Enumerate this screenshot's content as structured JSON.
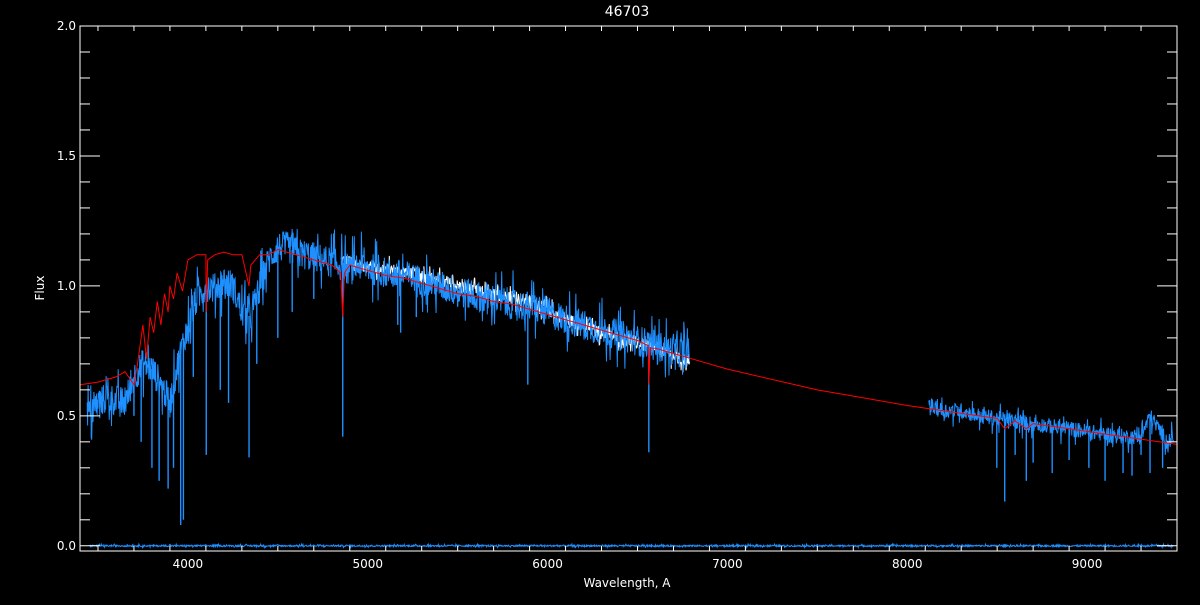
{
  "chart_data": {
    "type": "line",
    "title": "46703",
    "xlabel": "Wavelength, A",
    "ylabel": "Flux",
    "xlim": [
      3400,
      9500
    ],
    "ylim": [
      -0.02,
      2.0
    ],
    "xticks": [
      4000,
      5000,
      6000,
      7000,
      8000,
      9000
    ],
    "xtick_labels": [
      "4000",
      "5000",
      "6000",
      "7000",
      "8000",
      "9000"
    ],
    "yticks": [
      0.0,
      0.5,
      1.0,
      1.5,
      2.0
    ],
    "ytick_labels": [
      "0.0",
      "0.5",
      "1.0",
      "1.5",
      "2.0"
    ],
    "grid": false,
    "background": "#000000",
    "axis_color": "#ffffff",
    "series": [
      {
        "color": "#ffffff",
        "x": [
          4850,
          4950,
          5050,
          5150,
          5250,
          5350,
          5450,
          5550,
          5650,
          5750,
          5850,
          5950,
          6050,
          6150,
          6250,
          6350,
          6450,
          6550,
          6650,
          6700,
          6750,
          6790
        ],
        "y": [
          1.1,
          1.08,
          1.07,
          1.06,
          1.05,
          1.03,
          1.01,
          0.99,
          0.97,
          0.96,
          0.95,
          0.93,
          0.89,
          0.86,
          0.83,
          0.81,
          0.79,
          0.77,
          0.75,
          0.73,
          0.71,
          0.72
        ],
        "noise": 0.025
      },
      {
        "color": "#1e90ff",
        "x": [
          3440,
          3460,
          3500,
          3550,
          3600,
          3650,
          3700,
          3750,
          3800,
          3850,
          3900,
          3950,
          4000,
          4050,
          4100,
          4150,
          4200,
          4250,
          4300,
          4350,
          4400,
          4450,
          4500,
          4550,
          4600,
          4650,
          4700,
          4750,
          4800,
          4850,
          4900,
          4950,
          5000,
          5100,
          5200,
          5300,
          5400,
          5500,
          5600,
          5700,
          5800,
          5900,
          6000,
          6100,
          6200,
          6300,
          6400,
          6500,
          6600,
          6700,
          6790
        ],
        "y": [
          0.52,
          0.5,
          0.55,
          0.57,
          0.56,
          0.55,
          0.65,
          0.7,
          0.68,
          0.62,
          0.55,
          0.72,
          0.85,
          0.95,
          1.0,
          0.99,
          1.02,
          1.0,
          0.9,
          0.88,
          1.0,
          1.1,
          1.15,
          1.15,
          1.13,
          1.12,
          1.11,
          1.1,
          1.09,
          1.08,
          1.06,
          1.08,
          1.07,
          1.05,
          1.04,
          1.02,
          1.0,
          0.98,
          0.96,
          0.95,
          0.93,
          0.92,
          0.9,
          0.87,
          0.85,
          0.83,
          0.81,
          0.79,
          0.77,
          0.75,
          0.74
        ],
        "noise": 0.06,
        "lines": [
          [
            3840,
            0.25
          ],
          [
            3890,
            0.22
          ],
          [
            3960,
            0.08
          ],
          [
            3975,
            0.1
          ],
          [
            4102,
            0.35
          ],
          [
            4340,
            0.34
          ],
          [
            4861,
            0.42
          ],
          [
            5270,
            0.88
          ],
          [
            5890,
            0.62
          ],
          [
            6563,
            0.36
          ],
          [
            3700,
            0.5
          ],
          [
            3740,
            0.4
          ],
          [
            3800,
            0.3
          ],
          [
            3920,
            0.3
          ],
          [
            4030,
            0.65
          ],
          [
            4180,
            0.6
          ],
          [
            4226,
            0.55
          ],
          [
            4383,
            0.7
          ],
          [
            4500,
            0.8
          ],
          [
            4580,
            0.9
          ],
          [
            4700,
            0.95
          ],
          [
            5167,
            0.85
          ],
          [
            5183,
            0.82
          ],
          [
            5500,
            0.92
          ]
        ]
      },
      {
        "color": "#1e90ff",
        "x": [
          8120,
          8150,
          8200,
          8300,
          8400,
          8500,
          8600,
          8700,
          8800,
          8900,
          9000,
          9100,
          9200,
          9300,
          9350,
          9400,
          9450,
          9480
        ],
        "y": [
          0.55,
          0.53,
          0.52,
          0.52,
          0.5,
          0.49,
          0.48,
          0.47,
          0.46,
          0.45,
          0.44,
          0.43,
          0.42,
          0.42,
          0.5,
          0.45,
          0.4,
          0.42
        ],
        "noise": 0.03,
        "lines": [
          [
            8498,
            0.3
          ],
          [
            8542,
            0.17
          ],
          [
            8662,
            0.25
          ],
          [
            8600,
            0.35
          ],
          [
            8700,
            0.32
          ],
          [
            8806,
            0.28
          ],
          [
            8900,
            0.33
          ],
          [
            9010,
            0.3
          ],
          [
            9100,
            0.25
          ],
          [
            9200,
            0.28
          ],
          [
            9250,
            0.27
          ],
          [
            9300,
            0.35
          ],
          [
            9350,
            0.28
          ],
          [
            9420,
            0.3
          ]
        ]
      },
      {
        "color": "#ff0000",
        "x": [
          3400,
          3500,
          3600,
          3650,
          3700,
          3720,
          3750,
          3770,
          3790,
          3810,
          3830,
          3850,
          3870,
          3890,
          3900,
          3920,
          3940,
          3970,
          4000,
          4050,
          4100,
          4102,
          4110,
          4150,
          4200,
          4250,
          4300,
          4340,
          4350,
          4400,
          4450,
          4500,
          4550,
          4600,
          4650,
          4700,
          4800,
          4850,
          4861,
          4870,
          4900,
          5000,
          5100,
          5200,
          5300,
          5400,
          5500,
          5600,
          5700,
          5800,
          5900,
          6000,
          6100,
          6200,
          6300,
          6400,
          6500,
          6560,
          6563,
          6570,
          6600,
          6700,
          6800,
          7000,
          7500,
          8000,
          8200,
          8400,
          8500,
          8542,
          8600,
          8662,
          8700,
          8800,
          8900,
          9000,
          9100,
          9200,
          9300,
          9400,
          9500
        ],
        "y": [
          0.62,
          0.63,
          0.65,
          0.67,
          0.62,
          0.7,
          0.85,
          0.72,
          0.88,
          0.82,
          0.94,
          0.85,
          0.97,
          0.9,
          1.0,
          0.95,
          1.05,
          0.98,
          1.1,
          1.12,
          1.12,
          0.9,
          1.1,
          1.12,
          1.13,
          1.12,
          1.12,
          1.0,
          1.08,
          1.12,
          1.12,
          1.14,
          1.13,
          1.12,
          1.11,
          1.1,
          1.08,
          1.05,
          0.88,
          1.05,
          1.08,
          1.06,
          1.04,
          1.03,
          1.01,
          0.99,
          0.97,
          0.96,
          0.94,
          0.93,
          0.91,
          0.89,
          0.87,
          0.85,
          0.83,
          0.81,
          0.79,
          0.77,
          0.62,
          0.76,
          0.76,
          0.74,
          0.72,
          0.68,
          0.6,
          0.54,
          0.52,
          0.5,
          0.49,
          0.45,
          0.48,
          0.45,
          0.47,
          0.46,
          0.45,
          0.44,
          0.43,
          0.42,
          0.41,
          0.4,
          0.39
        ]
      },
      {
        "color": "#1e90ff",
        "x": [
          3450,
          4000,
          5000,
          6000,
          7000,
          8000,
          9000,
          9480
        ],
        "y": [
          0.0,
          0.0,
          0.0,
          0.0,
          0.0,
          0.0,
          0.0,
          0.0
        ],
        "noise": 0.003
      }
    ]
  }
}
